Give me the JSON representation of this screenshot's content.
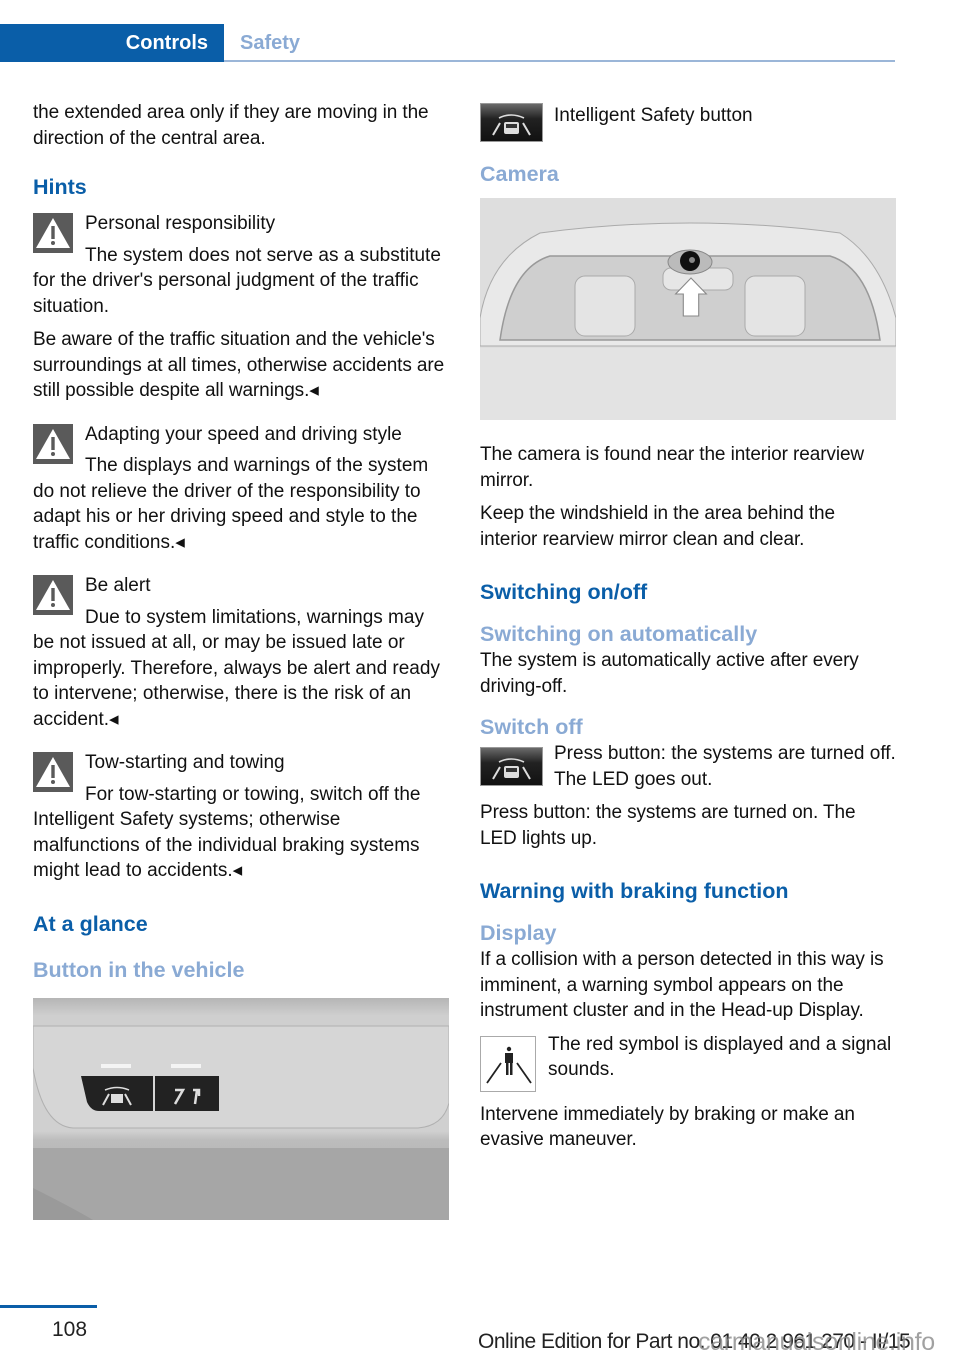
{
  "header": {
    "tabs": [
      {
        "label": "Controls",
        "active": true
      },
      {
        "label": "Safety",
        "active": false
      }
    ]
  },
  "left": {
    "intro": "the extended area only if they are moving in the direction of the central area.",
    "hints_heading": "Hints",
    "warnings": [
      {
        "title": "Personal responsibility",
        "text": "The system does not serve as a substitute for the driver's personal judgment of the traffic situation.",
        "extra": "Be aware of the traffic situation and the vehicle's surroundings at all times, otherwise accidents are still possible despite all warnings.◂"
      },
      {
        "title": "Adapting your speed and driving style",
        "text": "The displays and warnings of the system do not relieve the driver of the responsibility to adapt his or her driving speed and style to the traffic conditions.◂"
      },
      {
        "title": "Be alert",
        "text": "Due to system limitations, warnings may be not issued at all, or may be issued late or improperly. Therefore, always be alert and ready to intervene; otherwise, there is the risk of an accident.◂"
      },
      {
        "title": "Tow-starting and towing",
        "text": "For tow-starting or towing, switch off the Intelligent Safety systems; otherwise malfunctions of the individual braking systems might lead to accidents.◂"
      }
    ],
    "at_a_glance_heading": "At a glance",
    "button_heading": "Button in the vehicle",
    "console_image_alt": "Button console with Intelligent Safety and lane departure buttons"
  },
  "right": {
    "button_caption": "Intelligent Safety button",
    "camera_heading": "Camera",
    "camera_image_alt": "Windshield with camera near interior rearview mirror",
    "camera_text_1": "The camera is found near the interior rearview mirror.",
    "camera_text_2": "Keep the windshield in the area behind the interior rearview mirror clean and clear.",
    "switching_heading": "Switching on/off",
    "switching_auto_heading": "Switching on automatically",
    "switching_auto_text": "The system is automatically active after every driving-off.",
    "switch_off_heading": "Switch off",
    "switch_off_button_text": "Press button: the systems are turned off. The LED goes out.",
    "switch_on_text": "Press button: the systems are turned on. The LED lights up.",
    "warning_braking_heading": "Warning with braking function",
    "display_heading": "Display",
    "display_text": "If a collision with a person detected in this way is imminent, a warning symbol appears on the instrument cluster and in the Head-up Display.",
    "red_symbol_text": "The red symbol is displayed and a signal sounds.",
    "intervene_text": "Intervene immediately by braking or make an evasive maneuver."
  },
  "footer": {
    "page_number": "108",
    "edition": "Online Edition for Part no. 01 40 2 961 270 - II/15",
    "watermark": "carmanualsonline.info"
  },
  "colors": {
    "primary_blue": "#0a5ea8",
    "light_blue": "#8aaad4"
  }
}
